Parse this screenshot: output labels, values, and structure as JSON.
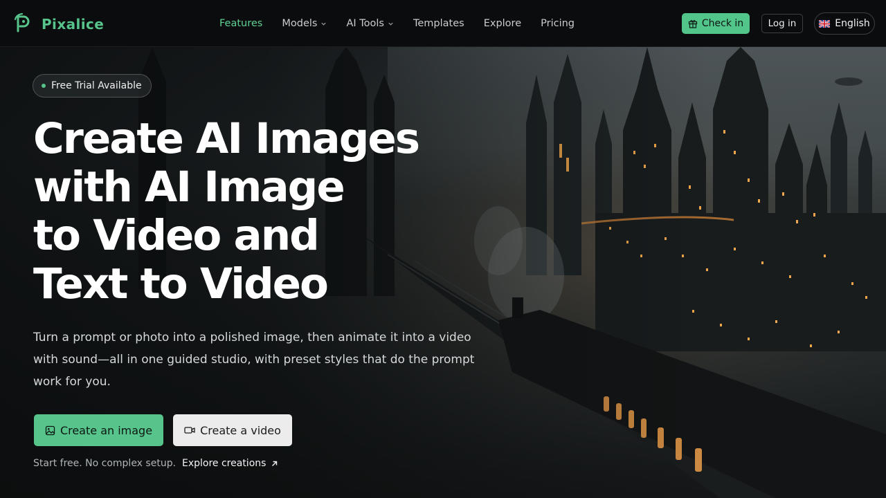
{
  "brand": {
    "name": "Pixalice",
    "logo_icon": "pixalice-logo-icon"
  },
  "nav": {
    "items": [
      {
        "label": "Features",
        "active": true,
        "dropdown": false
      },
      {
        "label": "Models",
        "active": false,
        "dropdown": true
      },
      {
        "label": "AI Tools",
        "active": false,
        "dropdown": true
      },
      {
        "label": "Templates",
        "active": false,
        "dropdown": false
      },
      {
        "label": "Explore",
        "active": false,
        "dropdown": false
      },
      {
        "label": "Pricing",
        "active": false,
        "dropdown": false
      }
    ]
  },
  "header_actions": {
    "checkin_label": "Check in",
    "checkin_icon": "gift-icon",
    "login_label": "Log in",
    "language_label": "English",
    "language_icon": "uk-flag-icon"
  },
  "hero": {
    "badge": "Free Trial Available",
    "headline_lines": [
      "Create AI Images",
      "with AI Image",
      "to Video and",
      "Text to Video"
    ],
    "subtitle": "Turn a prompt or photo into a polished image, then animate it into a video with sound—all in one guided studio, with preset styles that do the prompt work for you.",
    "primary_cta": "Create an image",
    "primary_cta_icon": "image-icon",
    "secondary_cta": "Create a video",
    "secondary_cta_icon": "video-camera-icon",
    "footnote": "Start free. No complex setup.",
    "explore_link": "Explore creations",
    "explore_icon": "arrow-up-right-icon"
  },
  "colors": {
    "accent": "#57c48c",
    "header_bg": "#0b0c0d",
    "secondary_button": "#ececec"
  }
}
